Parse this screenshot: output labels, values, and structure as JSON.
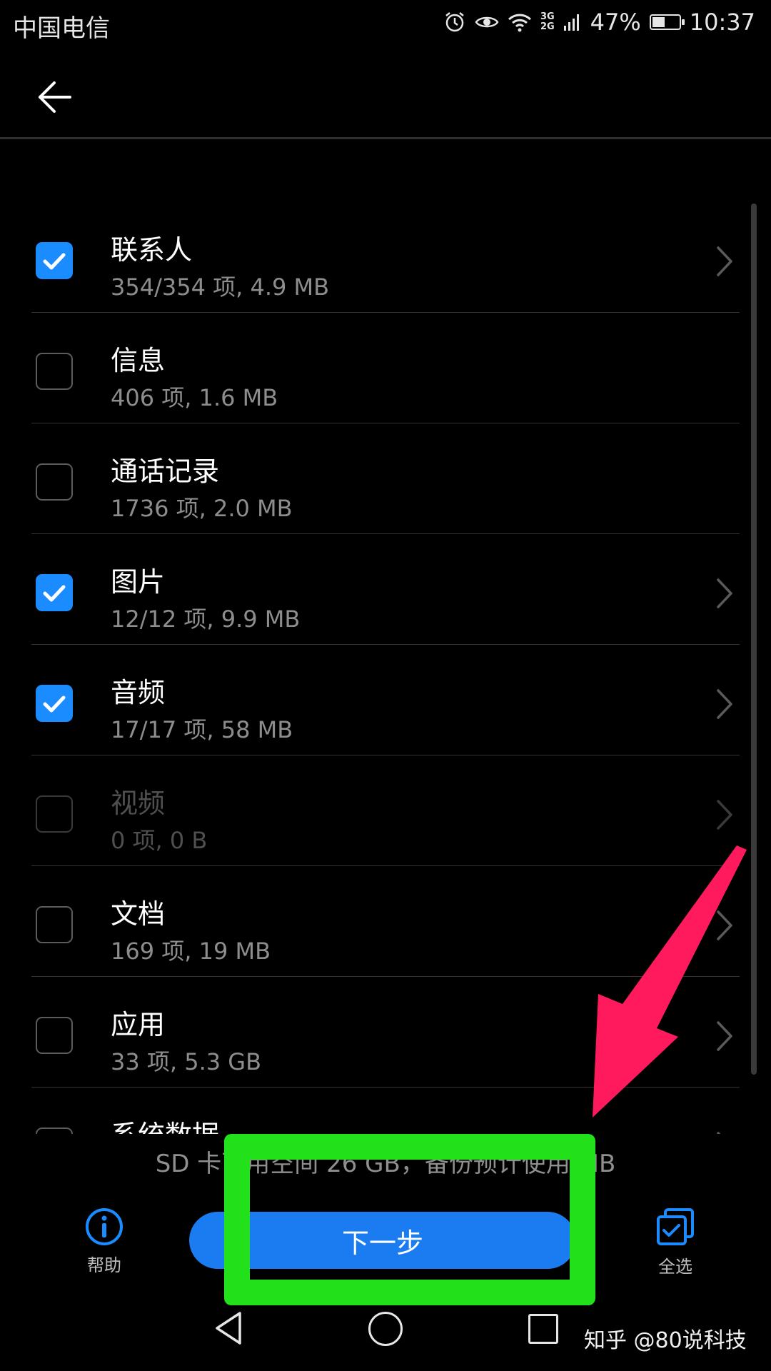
{
  "status_bar": {
    "carrier": "中国电信",
    "network_top": "3G",
    "network_bottom": "2G",
    "battery_text": "47%",
    "battery_level": 0.47,
    "time": "10:37",
    "icons": [
      "alarm-icon",
      "eye-icon",
      "wifi-icon",
      "signal-icon",
      "battery-icon"
    ]
  },
  "items": [
    {
      "title": "联系人",
      "subtitle": "354/354 项, 4.9 MB",
      "checked": true,
      "enabled": true
    },
    {
      "title": "信息",
      "subtitle": "406 项, 1.6 MB",
      "checked": false,
      "enabled": true
    },
    {
      "title": "通话记录",
      "subtitle": "1736 项, 2.0 MB",
      "checked": false,
      "enabled": true
    },
    {
      "title": "图片",
      "subtitle": "12/12 项, 9.9 MB",
      "checked": true,
      "enabled": true
    },
    {
      "title": "音频",
      "subtitle": "17/17 项, 58 MB",
      "checked": true,
      "enabled": true
    },
    {
      "title": "视频",
      "subtitle": "0 项, 0 B",
      "checked": false,
      "enabled": false
    },
    {
      "title": "文档",
      "subtitle": "169 项, 19 MB",
      "checked": false,
      "enabled": true
    },
    {
      "title": "应用",
      "subtitle": "33 项, 5.3 GB",
      "checked": false,
      "enabled": true
    },
    {
      "title": "系统数据",
      "subtitle": "",
      "checked": false,
      "enabled": true
    }
  ],
  "storage_info": "SD 卡可用空间 26 GB，备份预计使用 MB",
  "buttons": {
    "help_label": "帮助",
    "next_label": "下一步",
    "select_all_label": "全选"
  },
  "watermark": "知乎 @80说科技",
  "colors": {
    "accent": "#1a7cf0",
    "checkbox": "#1a8cff",
    "highlight_box": "#22e01a",
    "arrow": "#ff1a5e"
  }
}
